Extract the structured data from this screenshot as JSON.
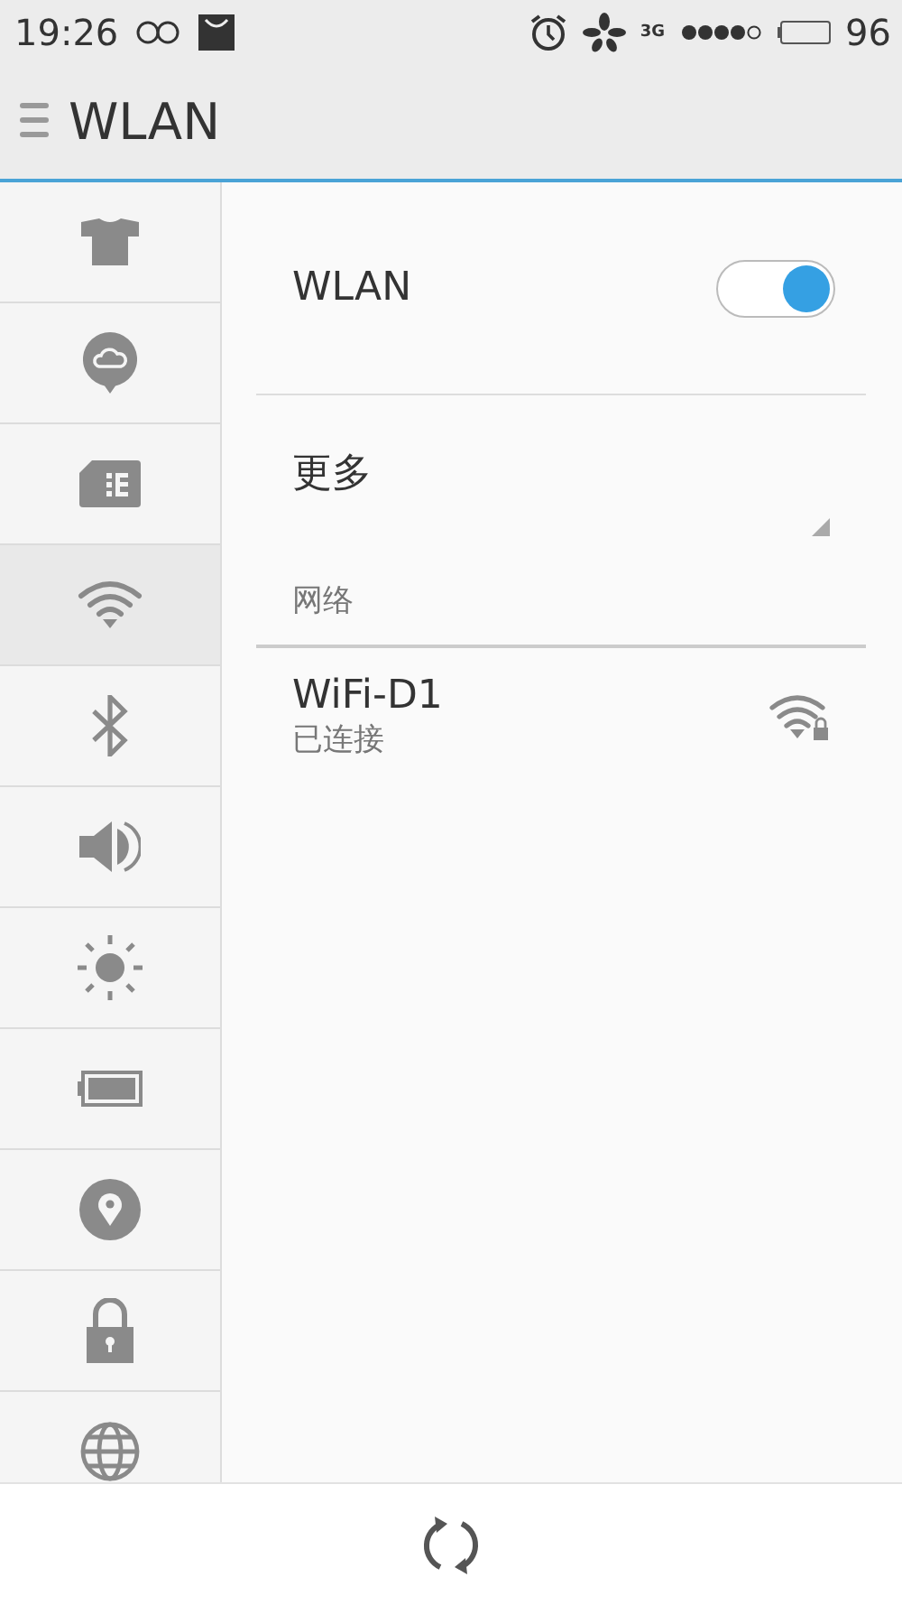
{
  "status_bar": {
    "time": "19:26",
    "network": "3G",
    "battery": "96"
  },
  "header": {
    "title": "WLAN"
  },
  "sidebar": {
    "items": [
      {
        "kind": "shirt",
        "selected": false
      },
      {
        "kind": "cloud",
        "selected": false
      },
      {
        "kind": "sim",
        "selected": false
      },
      {
        "kind": "wifi",
        "selected": true
      },
      {
        "kind": "bluetooth",
        "selected": false
      },
      {
        "kind": "speaker",
        "selected": false
      },
      {
        "kind": "sun",
        "selected": false
      },
      {
        "kind": "battery",
        "selected": false
      },
      {
        "kind": "pin",
        "selected": false
      },
      {
        "kind": "lock",
        "selected": false
      },
      {
        "kind": "globe",
        "selected": false
      }
    ]
  },
  "wlan": {
    "label": "WLAN",
    "on": true
  },
  "more": {
    "label": "更多"
  },
  "networks": {
    "heading": "网络",
    "items": [
      {
        "name": "WiFi-D1",
        "status": "已连接",
        "locked": true
      }
    ]
  }
}
